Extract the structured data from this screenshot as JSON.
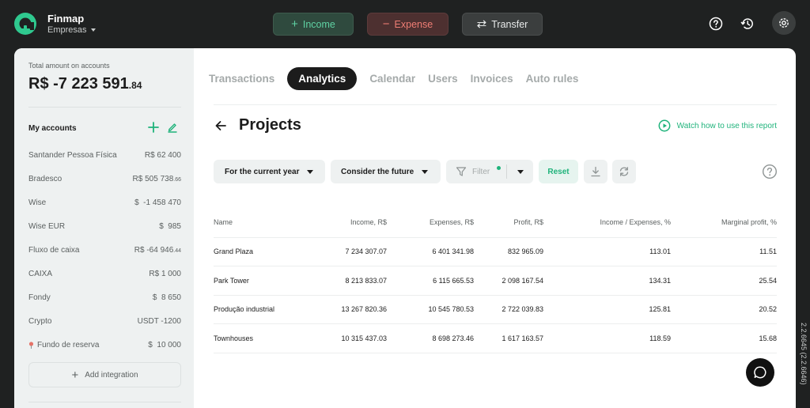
{
  "header": {
    "brand": "Finmap",
    "company": "Empresas",
    "buttons": {
      "income": "Income",
      "expense": "Expense",
      "transfer": "Transfer"
    },
    "symbols": {
      "income": "+",
      "expense": "−",
      "transfer": "⇄"
    }
  },
  "sidebar": {
    "total_label": "Total amount on accounts",
    "total_main": "R$ -7 223 591",
    "total_cents": ".84",
    "my_accounts_label": "My accounts",
    "accounts": [
      {
        "name": "Santander Pessoa Física",
        "balance": "R$ 62 400",
        "cents": ""
      },
      {
        "name": "Bradesco",
        "balance": "R$ 505 738",
        "cents": ".66"
      },
      {
        "name": "Wise",
        "balance": "$  -1 458 470",
        "cents": ""
      },
      {
        "name": "Wise EUR",
        "balance": "$  985",
        "cents": ""
      },
      {
        "name": "Fluxo de caixa",
        "balance": "R$ -64 946",
        "cents": ".44"
      },
      {
        "name": "CAIXA",
        "balance": "R$ 1 000",
        "cents": ""
      },
      {
        "name": "Fondy",
        "balance": "$  8 650",
        "cents": ""
      },
      {
        "name": "Crypto",
        "balance": "USDT -1200",
        "cents": ""
      },
      {
        "name": "Fundo de reserva",
        "balance": "$  10 000",
        "cents": ""
      }
    ],
    "add_integration": "Add integration"
  },
  "tabs": [
    {
      "label": "Transactions",
      "active": false
    },
    {
      "label": "Analytics",
      "active": true
    },
    {
      "label": "Calendar",
      "active": false
    },
    {
      "label": "Users",
      "active": false
    },
    {
      "label": "Invoices",
      "active": false
    },
    {
      "label": "Auto rules",
      "active": false
    }
  ],
  "report": {
    "title": "Projects",
    "watch_link": "Watch how to use this report",
    "filters": {
      "period": "For the current year",
      "future": "Consider the future",
      "filter": "Filter",
      "reset": "Reset"
    },
    "columns": [
      "Name",
      "Income, R$",
      "Expenses, R$",
      "Profit, R$",
      "Income / Expenses, %",
      "Marginal profit, %"
    ],
    "rows": [
      [
        "Grand Plaza",
        "7 234 307.07",
        "6 401 341.98",
        "832 965.09",
        "113.01",
        "11.51"
      ],
      [
        "Park Tower",
        "8 213 833.07",
        "6 115 665.53",
        "2 098 167.54",
        "134.31",
        "25.54"
      ],
      [
        "Produção industrial",
        "13 267 820.36",
        "10 545 780.53",
        "2 722 039.83",
        "125.81",
        "20.52"
      ],
      [
        "Townhouses",
        "10 315 437.03",
        "8 698 273.46",
        "1 617 163.57",
        "118.59",
        "15.68"
      ]
    ]
  },
  "version": "2.2.6645 (2.2.6646)",
  "colors": {
    "accent": "#1fb37b",
    "expense": "#ee7d74",
    "dark": "#1c1c1c"
  }
}
